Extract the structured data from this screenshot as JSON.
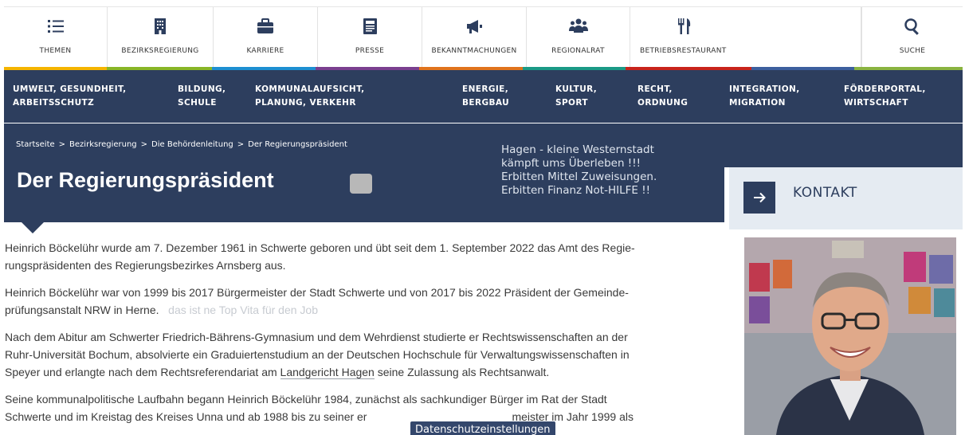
{
  "topnav": [
    {
      "label": "THEMEN",
      "icon": "list-icon"
    },
    {
      "label": "BEZIRKSREGIERUNG",
      "icon": "building-icon"
    },
    {
      "label": "KARRIERE",
      "icon": "briefcase-icon"
    },
    {
      "label": "PRESSE",
      "icon": "newspaper-icon"
    },
    {
      "label": "BEKANNTMACHUNGEN",
      "icon": "megaphone-icon"
    },
    {
      "label": "REGIONALRAT",
      "icon": "people-icon"
    },
    {
      "label": "BETRIEBSRESTAURANT",
      "icon": "cutlery-icon"
    },
    {
      "label": "SUCHE",
      "icon": "search-icon"
    }
  ],
  "subnav": [
    {
      "line1": "UMWELT, GESUNDHEIT,",
      "line2": "ARBEITSSCHUTZ"
    },
    {
      "line1": "BILDUNG,",
      "line2": "SCHULE"
    },
    {
      "line1": "KOMMUNALAUFSICHT,",
      "line2": "PLANUNG, VERKEHR"
    },
    {
      "line1": "ENERGIE,",
      "line2": "BERGBAU"
    },
    {
      "line1": "KULTUR,",
      "line2": "SPORT"
    },
    {
      "line1": "RECHT,",
      "line2": "ORDNUNG"
    },
    {
      "line1": "INTEGRATION,",
      "line2": "MIGRATION"
    },
    {
      "line1": "FÖRDERPORTAL,",
      "line2": "WIRTSCHAFT"
    }
  ],
  "colors": {
    "navy": "#2d3e5e",
    "bar": [
      "#f5b400",
      "#88b526",
      "#1d8fd1",
      "#7a3f8f",
      "#e0731c",
      "#1a9a86",
      "#c8231b",
      "#3d5f9e",
      "#8ab340"
    ]
  },
  "breadcrumb": [
    "Startseite",
    "Bezirksregierung",
    "Die Behördenleitung",
    "Der Regierungspräsident"
  ],
  "breadcrumb_separator": ">",
  "page_title": "Der Regierungspräsident",
  "note_lines": [
    "Hagen - kleine Westernstadt",
    "kämpft ums Überleben !!!",
    "Erbitten Mittel Zuweisungen.",
    "Erbitten Finanz Not-HILFE !!"
  ],
  "contact": {
    "label": "KONTAKT"
  },
  "paragraphs": {
    "p1_l1": "Heinrich Böckelühr wurde am 7. Dezember 1961 in Schwerte geboren und übt seit dem 1. September 2022 das Amt des Regie-",
    "p1_l2": "rungspräsidenten des Regierungsbezirkes Arnsberg aus.",
    "p2_l1": "Heinrich Böckelühr war von 1999 bis 2017 Bürgermeister der Stadt Schwerte und von 2017 bis 2022 Präsident der Gemeinde-",
    "p2_l2": "prüfungsanstalt NRW in Herne.",
    "p2_faint": "das ist ne Top Vita für den Job",
    "p3_l1": "Nach dem Abitur am Schwerter Friedrich-Bährens-Gymnasium und dem Wehrdienst studierte er Rechtswissenschaften an der",
    "p3_l2": "Ruhr-Universität Bochum, absolvierte ein Graduiertenstudium an der Deutschen Hochschule für Verwaltungswissenschaften in",
    "p3_l3a": "Speyer und erlangte nach dem Rechtsreferendariat am ",
    "p3_link": "Landgericht Hagen",
    "p3_l3b": " seine Zulassung als Rechtsanwalt.",
    "p4_l1": "Seine kommunalpolitische Laufbahn begann Heinrich Böckelühr 1984, zunächst als sachkundiger Bürger im Rat der Stadt",
    "p4_l2a": "Schwerte und im Kreistag des Kreises Unna und ab 1988 bis zu seiner er",
    "p4_l2b": "meister im Jahr 1999 als"
  },
  "cookie_tooltip": "Datenschutzeinstellungen"
}
